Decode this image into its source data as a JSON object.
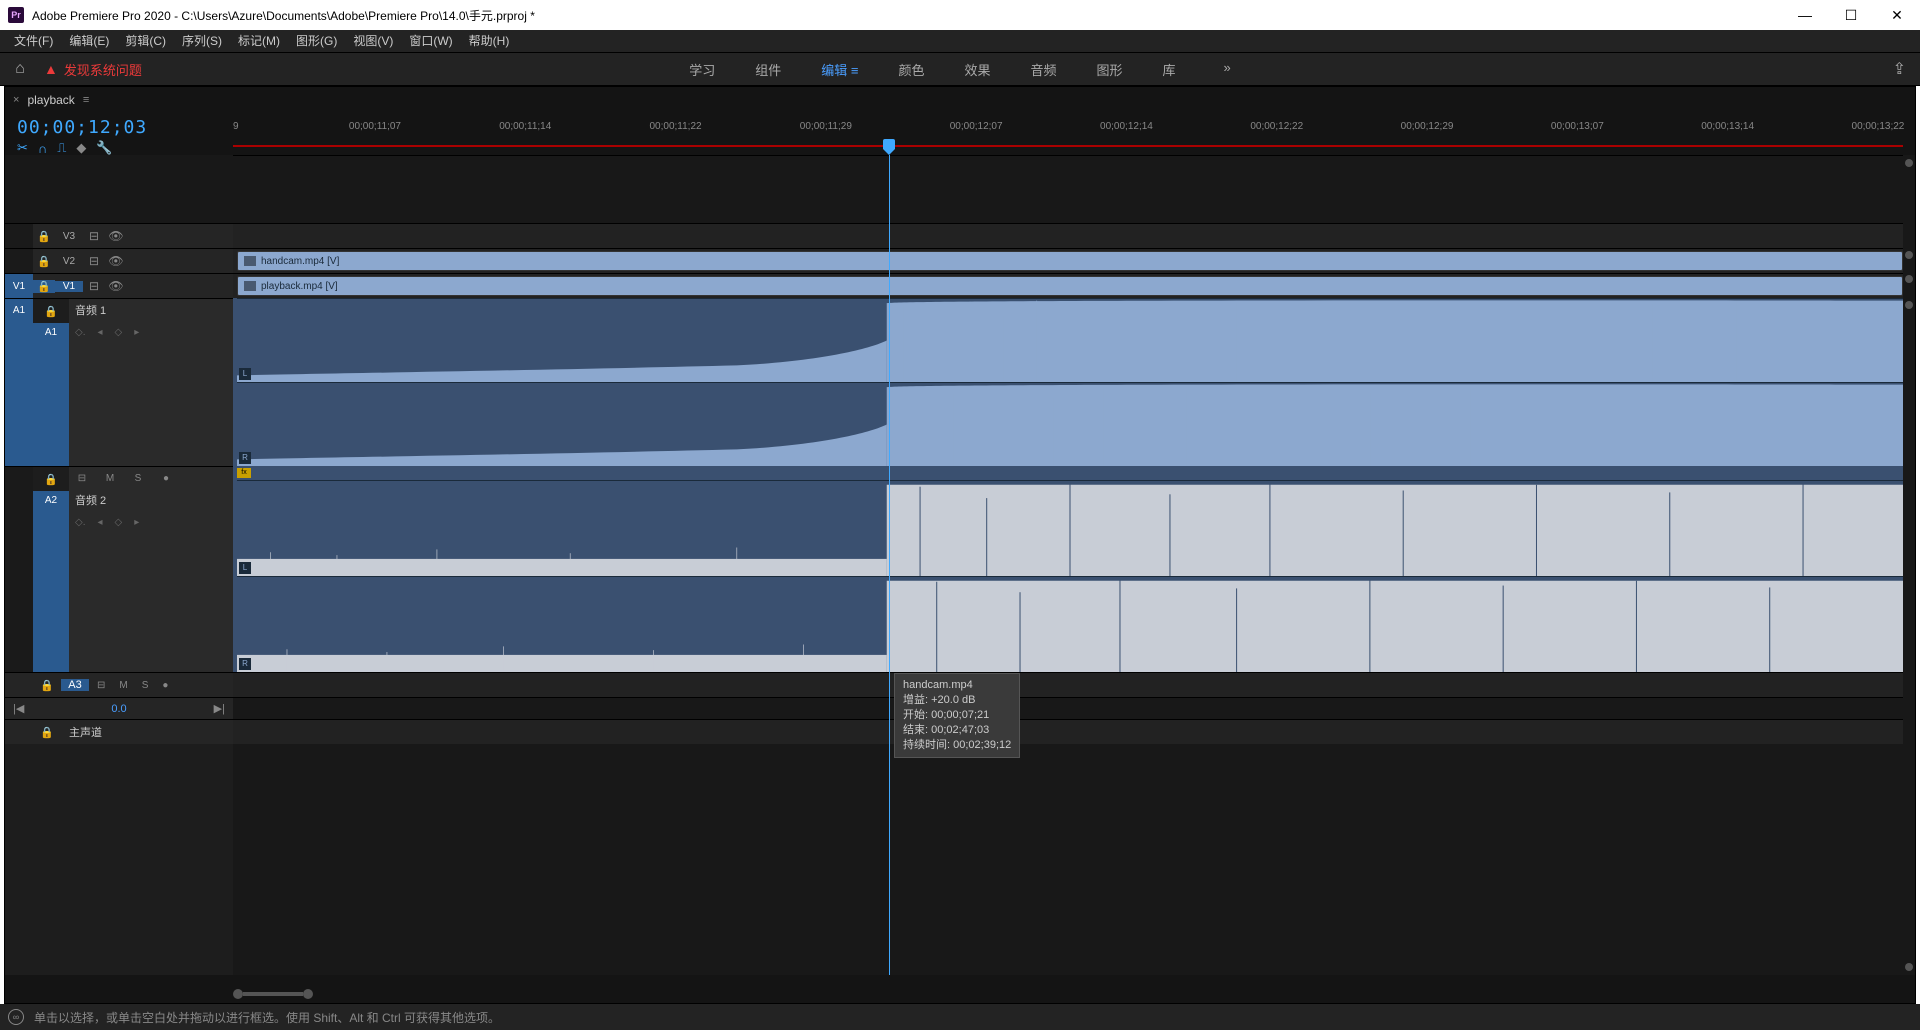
{
  "titlebar": {
    "app_icon_text": "Pr",
    "title": "Adobe Premiere Pro 2020 - C:\\Users\\Azure\\Documents\\Adobe\\Premiere Pro\\14.0\\手元.prproj *"
  },
  "menubar": [
    "文件(F)",
    "编辑(E)",
    "剪辑(C)",
    "序列(S)",
    "标记(M)",
    "图形(G)",
    "视图(V)",
    "窗口(W)",
    "帮助(H)"
  ],
  "wsbar": {
    "alert": "发现系统问题",
    "tabs": [
      "学习",
      "组件",
      "编辑",
      "颜色",
      "效果",
      "音频",
      "图形",
      "库"
    ],
    "active_index": 2,
    "overflow": "»"
  },
  "panel": {
    "tab_label": "playback",
    "timecode": "00;00;12;03",
    "ruler": {
      "first": "9",
      "ticks": [
        "00;00;11;07",
        "00;00;11;14",
        "00;00;11;22",
        "00;00;11;29",
        "00;00;12;07",
        "00;00;12;14",
        "00;00;12;22",
        "00;00;12;29",
        "00;00;13;07",
        "00;00;13;14",
        "00;00;13;22"
      ]
    }
  },
  "vtracks": [
    {
      "label": "V3"
    },
    {
      "label": "V2",
      "clip": "handcam.mp4 [V]"
    },
    {
      "label": "V1",
      "clip": "playback.mp4 [V]",
      "src_active": true
    }
  ],
  "atracks": {
    "a1": {
      "src": "A1",
      "label": "A1",
      "name": "音频 1",
      "channels": [
        "L",
        "R"
      ]
    },
    "a2": {
      "label": "A2",
      "name": "音频 2",
      "channels": [
        "L",
        "R"
      ],
      "fx": "fx"
    },
    "a3": {
      "label": "A3"
    },
    "master": {
      "label": "主声道"
    }
  },
  "controls": {
    "M": "M",
    "S": "S",
    "mic": "●",
    "keyframe": "◇.",
    "larrow": "◂",
    "diamond": "◇",
    "rarrow": "▸",
    "eye": "👁",
    "sync": "⊟",
    "lock": "🔒"
  },
  "pan": {
    "value": "0.0",
    "prev": "|◀",
    "next": "▶|"
  },
  "tooltip": {
    "name": "handcam.mp4",
    "gain": "增益: +20.0 dB",
    "start": "开始: 00;00;07;21",
    "end": "结束: 00;02;47;03",
    "duration": "持续时间: 00;02;39;12"
  },
  "statusbar": "单击以选择，或单击空白处并拖动以进行框选。使用 Shift、Alt 和 Ctrl 可获得其他选项。"
}
